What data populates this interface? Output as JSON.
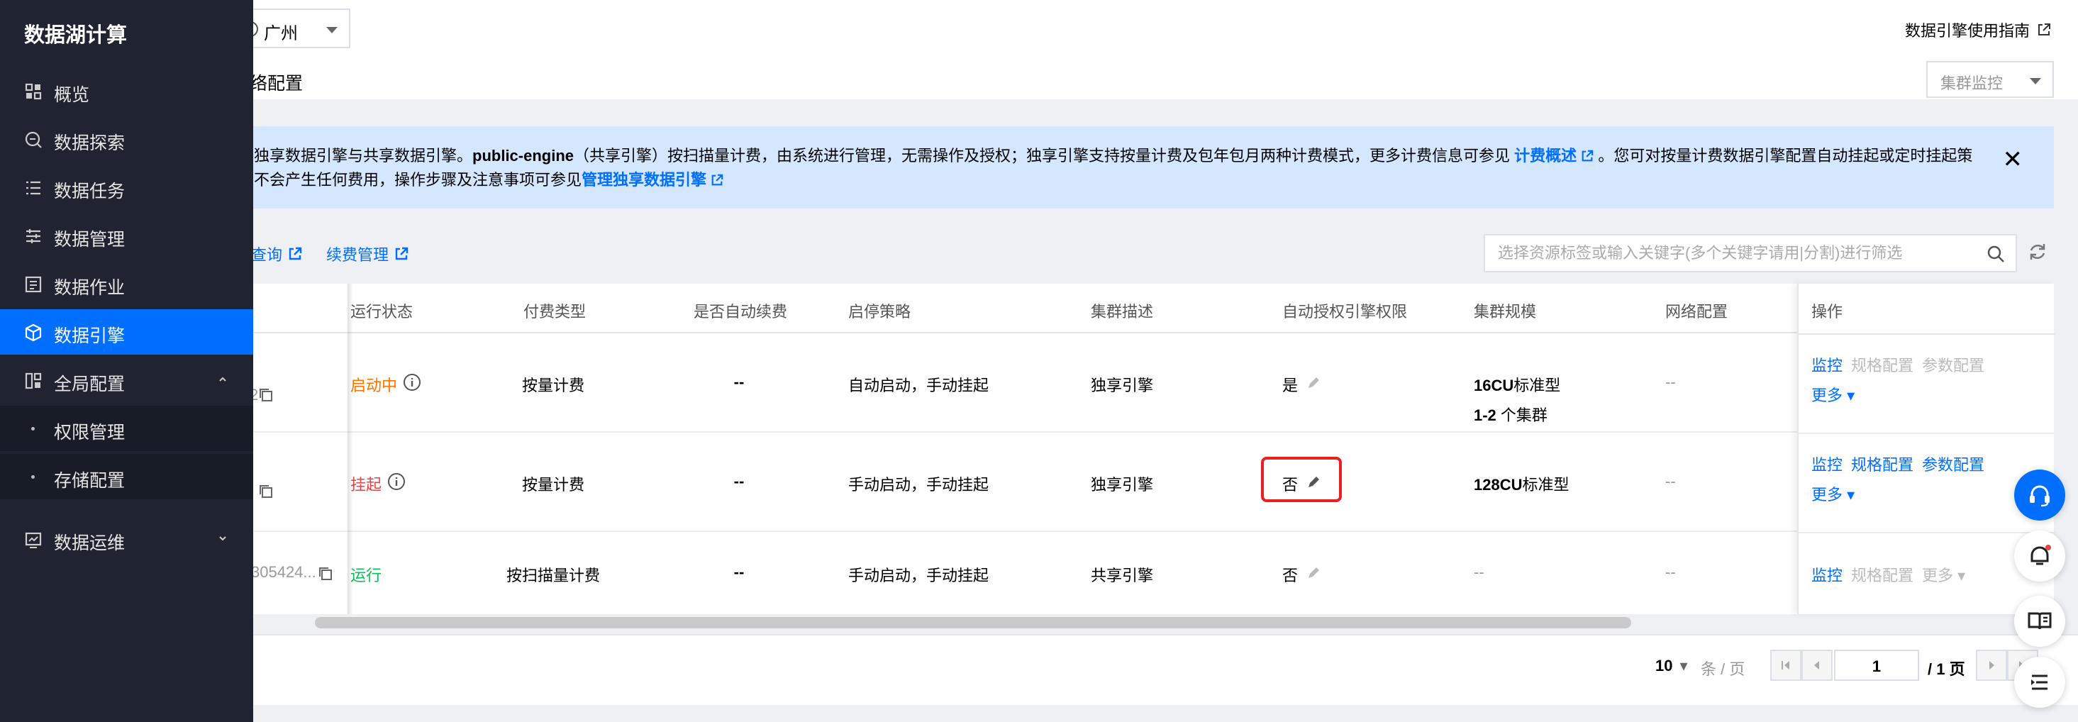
{
  "sidebar": {
    "title": "数据湖计算",
    "items": [
      {
        "label": "概览",
        "icon": "dashboard-icon"
      },
      {
        "label": "数据探索",
        "icon": "explore-icon"
      },
      {
        "label": "数据任务",
        "icon": "task-list-icon"
      },
      {
        "label": "数据管理",
        "icon": "data-manage-icon"
      },
      {
        "label": "数据作业",
        "icon": "job-icon"
      },
      {
        "label": "数据引擎",
        "icon": "engine-icon",
        "active": true
      },
      {
        "label": "全局配置",
        "icon": "global-config-icon",
        "expanded": true
      },
      {
        "label": "数据运维",
        "icon": "ops-icon"
      }
    ],
    "subitems": [
      {
        "label": "权限管理"
      },
      {
        "label": "存储配置"
      }
    ]
  },
  "header": {
    "region": "广州",
    "guide_link": "数据引擎使用指南",
    "subtitle": "络配置",
    "monitor_placeholder": "集群监控"
  },
  "notice": {
    "line1_a": "独享数据引擎与共享数据引擎。",
    "line1_b": "public-engine",
    "line1_c": "（共享引擎）按扫描量计费，由系统进行管理，无需操作及授权；独享引擎支持按量计费及包年包月两种计费模式，更多计费信息可参见",
    "line1_link": "计费概述",
    "line1_d": "。您可对按量计费数据引擎配置自动挂起或定时挂起策",
    "line2_a": "不会产生任何费用，操作步骤及注意事项可参见",
    "line2_link": "管理独享数据引擎"
  },
  "toolbar": {
    "link1": "查询",
    "link2": "续费管理",
    "search_placeholder": "选择资源标签或输入关键字(多个关键字请用|分割)进行筛选"
  },
  "table": {
    "columns": [
      "运行状态",
      "付费类型",
      "是否自动续费",
      "启停策略",
      "集群描述",
      "自动授权引擎权限",
      "集群规模",
      "网络配置",
      "操作"
    ],
    "rows": [
      {
        "id_fragment": "2",
        "status": "启动中",
        "pay_type": "按量计费",
        "auto_renew": "--",
        "strategy": "自动启动，手动挂起",
        "desc": "独享引擎",
        "auto_auth": "是",
        "scale_bold": "16CU",
        "scale_rest": "标准型",
        "scale2_bold": "1-2",
        "scale2_rest": " 个集群",
        "network": "--",
        "ops": [
          "监控",
          "规格配置",
          "参数配置"
        ],
        "more": "更多"
      },
      {
        "id_fragment": "",
        "status": "挂起",
        "pay_type": "按量计费",
        "auto_renew": "--",
        "strategy": "手动启动，手动挂起",
        "desc": "独享引擎",
        "auto_auth": "否",
        "scale_bold": "128CU",
        "scale_rest": "标准型",
        "network": "--",
        "ops": [
          "监控",
          "规格配置",
          "参数配置"
        ],
        "more": "更多"
      },
      {
        "id_fragment": "305424...",
        "status": "运行",
        "pay_type": "按扫描量计费",
        "auto_renew": "--",
        "strategy": "手动启动，手动挂起",
        "desc": "共享引擎",
        "auto_auth": "否",
        "scale": "--",
        "network": "--",
        "ops": [
          "监控",
          "规格配置"
        ],
        "more": "更多"
      }
    ]
  },
  "pagination": {
    "page_size": "10",
    "unit": "条 / 页",
    "current": "1",
    "total": "/ 1 页"
  },
  "colors": {
    "accent": "#006eff",
    "sidebar_bg": "#1f2430",
    "notice_bg": "#d5e7ff",
    "status_starting": "#ff7200",
    "status_suspended": "#e54545",
    "status_running": "#0abf5b",
    "highlight": "#e82020"
  }
}
